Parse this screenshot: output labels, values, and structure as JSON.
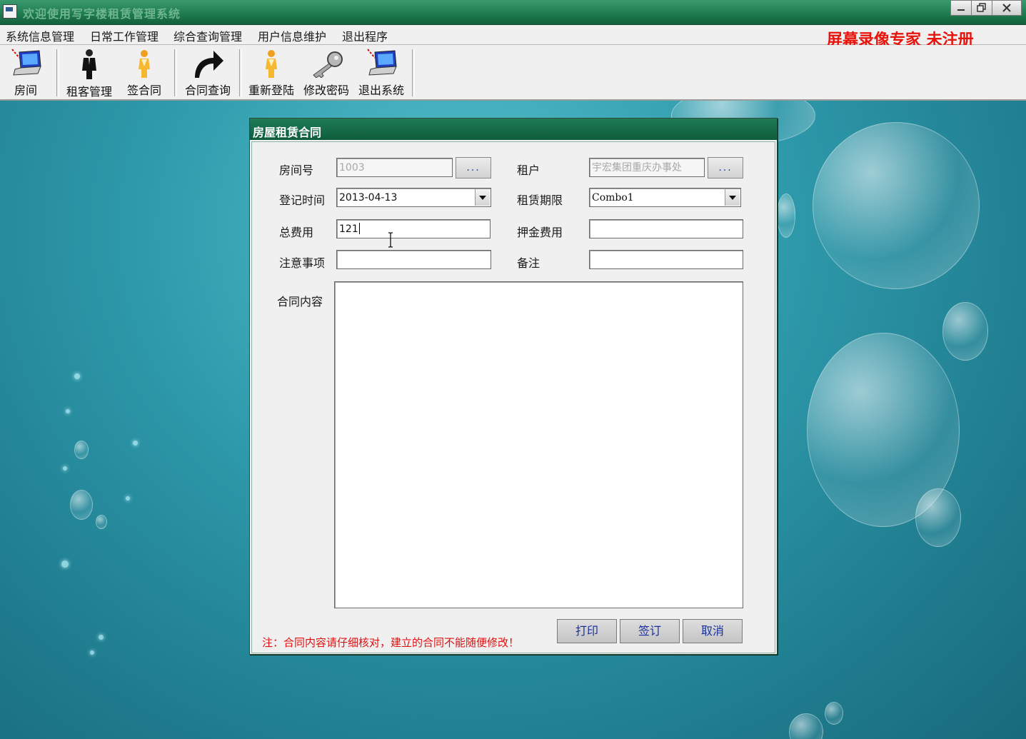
{
  "window": {
    "title": "欢迎使用写字楼租赁管理系统",
    "buttons": [
      "minimize",
      "restore",
      "close"
    ]
  },
  "menu": {
    "items": [
      "系统信息管理",
      "日常工作管理",
      "综合查询管理",
      "用户信息维护",
      "退出程序"
    ],
    "watermark": "屏幕录像专家  未注册"
  },
  "toolbar": {
    "items": [
      {
        "label": "房间",
        "icon": "laptop-icon"
      },
      {
        "label": "租客管理",
        "icon": "person-suit-icon"
      },
      {
        "label": "签合同",
        "icon": "person-icon"
      },
      {
        "label": "合同查询",
        "icon": "curved-arrow-icon"
      },
      {
        "label": "重新登陆",
        "icon": "person-icon"
      },
      {
        "label": "修改密码",
        "icon": "key-icon"
      },
      {
        "label": "退出系统",
        "icon": "laptop-icon"
      }
    ]
  },
  "dialog": {
    "title": "房屋租赁合同",
    "fields": {
      "room_no": {
        "label": "房间号",
        "value": "1003"
      },
      "tenant": {
        "label": "租户",
        "value": "宇宏集团重庆办事处"
      },
      "register_time": {
        "label": "登记时间",
        "value": "2013-04-13"
      },
      "lease_term": {
        "label": "租赁期限",
        "value": "Combo1"
      },
      "total_fee": {
        "label": "总费用",
        "value": "121"
      },
      "deposit_fee": {
        "label": "押金费用",
        "value": ""
      },
      "notes": {
        "label": "注意事项",
        "value": ""
      },
      "remark": {
        "label": "备注",
        "value": ""
      },
      "content": {
        "label": "合同内容",
        "value": ""
      }
    },
    "lookup_button": "...",
    "warning": "注：合同内容请仔细核对，建立的合同不能随便修改！",
    "buttons": {
      "print": "打印",
      "sign": "签订",
      "cancel": "取消"
    }
  },
  "colors": {
    "titlebar": "#1d7a4e",
    "dialog_title": "#0f5c3b",
    "warning_text": "#e01010",
    "watermark_text": "#e8140c",
    "button_text": "#1a2f9a"
  }
}
